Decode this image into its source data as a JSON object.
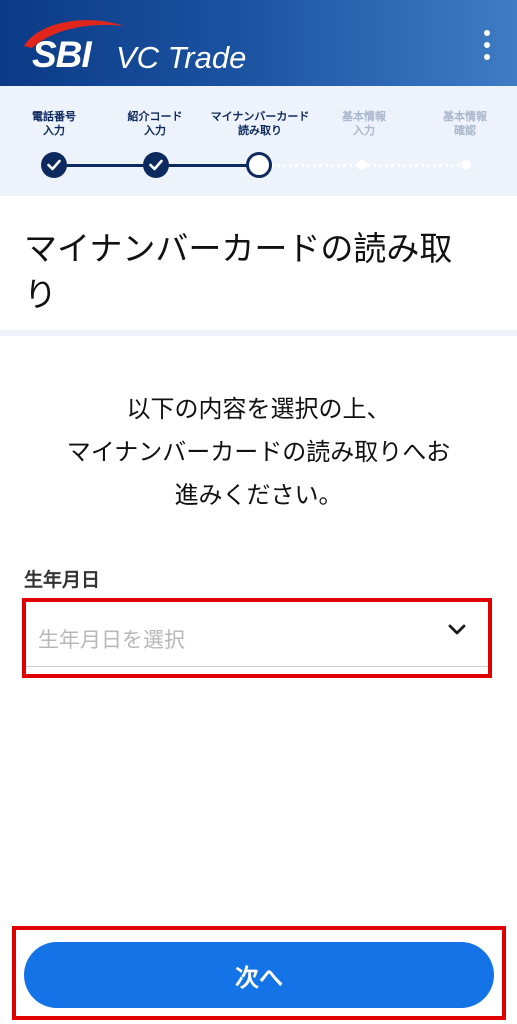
{
  "header": {
    "logo_sbi": "SBI",
    "logo_text": "VC Trade",
    "menu_icon": "kebab-menu-icon",
    "brand_color": "#0b3a86"
  },
  "stepper": {
    "steps": [
      {
        "line1": "電話番号",
        "line2": "入力",
        "state": "done"
      },
      {
        "line1": "紹介コード",
        "line2": "入力",
        "state": "done"
      },
      {
        "line1": "マイナンバーカード",
        "line2": "読み取り",
        "state": "current"
      },
      {
        "line1": "基本情報",
        "line2": "入力",
        "state": "future"
      },
      {
        "line1": "基本情報",
        "line2": "確認",
        "state": "future"
      }
    ],
    "active_color": "#0d2a5f",
    "inactive_color": "#a9b7cf"
  },
  "page": {
    "title_line1": "マイナンバーカードの読み取",
    "title_line2": "り",
    "instruction_line1": "以下の内容を選択の上、",
    "instruction_line2": "マイナンバーカードの読み取りへお",
    "instruction_line3": "進みください。"
  },
  "form": {
    "birthdate_label": "生年月日",
    "birthdate_placeholder": "生年月日を選択",
    "birthdate_value": ""
  },
  "actions": {
    "next_label": "次へ",
    "button_color": "#1473e6"
  },
  "highlight_color": "#e00000"
}
